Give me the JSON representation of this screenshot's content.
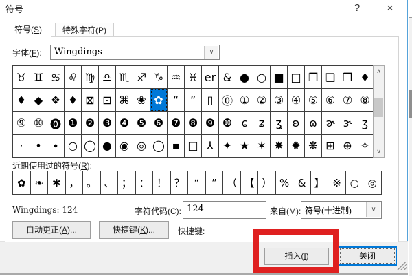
{
  "window": {
    "title": "符号"
  },
  "icons": {
    "help": "?",
    "close": "×",
    "dropdown": "∨",
    "scroll_up": "∧",
    "scroll_down": "∨"
  },
  "tabs": {
    "symbols": {
      "pre": "符号(",
      "key": "S",
      "post": ")"
    },
    "special": {
      "pre": "特殊字符(",
      "key": "P",
      "post": ")"
    }
  },
  "font_row": {
    "label_pre": "字体(",
    "label_key": "F",
    "label_post": "):",
    "value": "Wingdings"
  },
  "symbol_grid": {
    "rows": [
      [
        "♉",
        "♊",
        "♋",
        "♌",
        "♍",
        "♎",
        "♏",
        "♐",
        "♑",
        "♒",
        "♓",
        "er",
        "&",
        "●",
        "○",
        "■",
        "□",
        "❐",
        "❑",
        "❒",
        "♦"
      ],
      [
        "♦",
        "◆",
        "❖",
        "♦",
        "⊠",
        "⊡",
        "⌘",
        "❀",
        "✿",
        "“",
        "”",
        "▯",
        "⓪",
        "①",
        "②",
        "③",
        "④",
        "⑤",
        "⑥",
        "⑦",
        "⑧"
      ],
      [
        "⑨",
        "⑩",
        "⓿",
        "❶",
        "❷",
        "❸",
        "❹",
        "❺",
        "❻",
        "❼",
        "❽",
        "❾",
        "❿",
        "ɕ",
        "ʑ",
        "ʓ",
        "ʚ",
        "ɷ",
        "ɚ",
        "ɝ",
        "ʒ"
      ],
      [
        "·",
        "•",
        "∙",
        "○",
        "◯",
        "●",
        "◉",
        "◎",
        "◯",
        "▪",
        "□",
        "⅄",
        "✦",
        "★",
        "✶",
        "✸",
        "✹",
        "❋",
        "⊞",
        "⊕",
        "✧"
      ]
    ],
    "selected": {
      "row": 1,
      "col": 8
    }
  },
  "recent": {
    "label_pre": "近期使用过的符号(",
    "label_key": "R",
    "label_post": "):",
    "symbols": [
      "✿",
      "❧",
      "✱",
      "，",
      "。",
      "、",
      "；",
      "：",
      "！",
      "？",
      "“",
      "”",
      "（",
      "【",
      "）",
      "%",
      "&",
      "】",
      "※",
      "○",
      "◎"
    ]
  },
  "code_row": {
    "font_code_label": "Wingdings: 124",
    "char_code_pre": "字符代码(",
    "char_code_key": "C",
    "char_code_post": "):",
    "char_code_value": "124",
    "from_pre": "来自(",
    "from_key": "M",
    "from_post": "):",
    "from_value": "符号(十进制)"
  },
  "action_row": {
    "autocorrect_pre": "自动更正(",
    "autocorrect_key": "A",
    "autocorrect_post": ")...",
    "shortcut_btn_pre": "快捷键(",
    "shortcut_btn_key": "K",
    "shortcut_btn_post": ")...",
    "shortcut_label": "快捷键:"
  },
  "footer": {
    "insert_pre": "插入(",
    "insert_key": "I",
    "insert_post": ")",
    "close_label": "关闭"
  },
  "colors": {
    "selection_blue": "#0078d7",
    "dialog_border_blue": "#1b84d7",
    "annotation_red": "#df2020"
  }
}
